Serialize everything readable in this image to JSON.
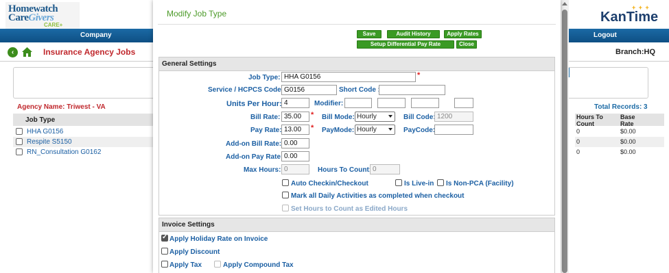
{
  "background": {
    "logo_left": {
      "line1": "Homewatch",
      "line2a": "Care",
      "line2b": "Givers",
      "line3": "CARE+"
    },
    "logo_right": {
      "text": "KanTime",
      "stars": "+ + +"
    },
    "nav": {
      "company": "Company",
      "logout": "Logout"
    },
    "page_title": "Insurance Agency Jobs",
    "branch": "Branch:HQ",
    "agency_name": "Agency Name: Triwest - VA",
    "total_records": "Total Records: 3",
    "list_header": "Job Type",
    "job_types": [
      "HHA G0156",
      "Respite S5150",
      "RN_Consultation G0162"
    ],
    "right_table": {
      "headers": [
        "Hours To Count",
        "Base Rate"
      ],
      "rows": [
        [
          "0",
          "$0.00"
        ],
        [
          "0",
          "$0.00"
        ],
        [
          "0",
          "$0.00"
        ]
      ]
    }
  },
  "modal": {
    "title": "Modify Job Type",
    "buttons": {
      "save": "Save",
      "audit_history": "Audit History",
      "apply_rates": "Apply Rates",
      "setup_differential": "Setup Differential Pay Rate",
      "close": "Close"
    },
    "general": {
      "header": "General Settings",
      "job_type_label": "Job Type:",
      "job_type_value": "HHA G0156",
      "service_label": "Service / HCPCS Code:",
      "service_value": "G0156",
      "short_code_label": "Short Code :",
      "short_code_value": "",
      "units_label": "Units Per Hour:",
      "units_value": "4",
      "modifier_label": "Modifier:",
      "bill_rate_label": "Bill Rate:",
      "bill_rate_value": "35.00",
      "bill_mode_label": "Bill Mode:",
      "bill_mode_value": "Hourly",
      "bill_code_label": "Bill Code:",
      "bill_code_value": "1200",
      "pay_rate_label": "Pay Rate:",
      "pay_rate_value": "13.00",
      "pay_mode_label": "PayMode:",
      "pay_mode_value": "Hourly",
      "pay_code_label": "PayCode:",
      "pay_code_value": "",
      "addon_bill_label": "Add-on Bill Rate:",
      "addon_bill_value": "0.00",
      "addon_pay_label": "Add-on Pay Rate:",
      "addon_pay_value": "0.00",
      "max_hours_label": "Max Hours:",
      "max_hours_value": "0",
      "hours_to_count_label": "Hours To Count:",
      "hours_to_count_value": "0",
      "auto_checkin": "Auto Checkin/Checkout",
      "is_live_in": "Is Live-in",
      "is_non_pca": "Is Non-PCA (Facility)",
      "mark_daily": "Mark all Daily Activities as completed when checkout",
      "set_hours": "Set Hours to Count as Edited Hours"
    },
    "invoice": {
      "header": "Invoice Settings",
      "holiday_rate": "Apply Holiday Rate on Invoice",
      "discount": "Apply Discount",
      "tax": "Apply Tax",
      "compound_tax": "Apply Compound Tax"
    }
  },
  "colors": {
    "nav_blue": "#1b6aa5",
    "button_green": "#3a9a24",
    "label_blue": "#1b5fa3",
    "title_red": "#c0282d",
    "modal_title_green": "#4b9a28"
  }
}
